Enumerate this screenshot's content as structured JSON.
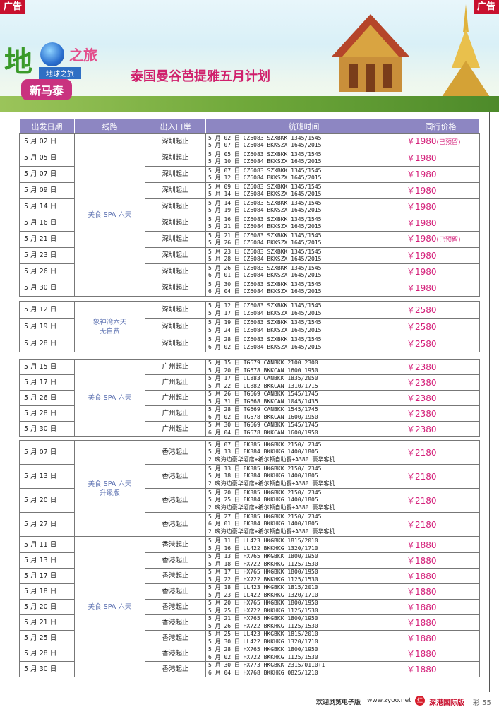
{
  "ad_label": "广告",
  "banner": {
    "logo_char": "地",
    "logo_brand": "Earth Tourism",
    "logo_zhilv": "之旅",
    "logo_caption": "地球之旅",
    "badge": "新马泰",
    "headline": "泰国曼谷芭提雅五月计划"
  },
  "columns": [
    "出发日期",
    "线路",
    "出入口岸",
    "航班时间",
    "同行价格"
  ],
  "groups": [
    {
      "route": [
        "美食 SPA 六天"
      ],
      "rows": [
        {
          "date": "5 月 02 日",
          "port": "深圳起止",
          "flights": [
            "5 月 02 日 CZ6083 SZXBKK 1345/1545",
            "5 月 07 日 CZ6084 BKKSZX 1645/2015"
          ],
          "price": "￥1980",
          "note": "(已预留)"
        },
        {
          "date": "5 月 05 日",
          "port": "深圳起止",
          "flights": [
            "5 月 05 日 CZ6083 SZXBKK 1345/1545",
            "5 月 10 日 CZ6084 BKKSZX 1645/2015"
          ],
          "price": "￥1980",
          "note": ""
        },
        {
          "date": "5 月 07 日",
          "port": "深圳起止",
          "flights": [
            "5 月 07 日 CZ6083 SZXBKK 1345/1545",
            "5 月 12 日 CZ6084 BKKSZX 1645/2015"
          ],
          "price": "￥1980",
          "note": ""
        },
        {
          "date": "5 月 09 日",
          "port": "深圳起止",
          "flights": [
            "5 月 09 日 CZ6083 SZXBKK 1345/1545",
            "5 月 14 日 CZ6084 BKKSZX 1645/2015"
          ],
          "price": "￥1980",
          "note": ""
        },
        {
          "date": "5 月 14 日",
          "port": "深圳起止",
          "flights": [
            "5 月 14 日 CZ6083 SZXBKK 1345/1545",
            "5 月 19 日 CZ6084 BKKSZX 1645/2015"
          ],
          "price": "￥1980",
          "note": ""
        },
        {
          "date": "5 月 16 日",
          "port": "深圳起止",
          "flights": [
            "5 月 16 日 CZ6083 SZXBKK 1345/1545",
            "5 月 21 日 CZ6084 BKKSZX 1645/2015"
          ],
          "price": "￥1980",
          "note": ""
        },
        {
          "date": "5 月 21 日",
          "port": "深圳起止",
          "flights": [
            "5 月 21 日 CZ6083 SZXBKK 1345/1545",
            "5 月 26 日 CZ6084 BKKSZX 1645/2015"
          ],
          "price": "￥1980",
          "note": "(已预留)"
        },
        {
          "date": "5 月 23 日",
          "port": "深圳起止",
          "flights": [
            "5 月 23 日 CZ6083 SZXBKK 1345/1545",
            "5 月 28 日 CZ6084 BKKSZX 1645/2015"
          ],
          "price": "￥1980",
          "note": ""
        },
        {
          "date": "5 月 26 日",
          "port": "深圳起止",
          "flights": [
            "5 月 26 日 CZ6083 SZXBKK 1345/1545",
            "6 月 01 日 CZ6084 BKKSZX 1645/2015"
          ],
          "price": "￥1980",
          "note": ""
        },
        {
          "date": "5 月 30 日",
          "port": "深圳起止",
          "flights": [
            "5 月 30 日 CZ6083 SZXBKK 1345/1545",
            "6 月 04 日 CZ6084 BKKSZX 1645/2015"
          ],
          "price": "￥1980",
          "note": ""
        }
      ]
    },
    {
      "route": [
        "象神湾六天",
        "无自费"
      ],
      "rows": [
        {
          "date": "5 月 12 日",
          "port": "深圳起止",
          "flights": [
            "5 月 12 日 CZ6083 SZXBKK 1345/1545",
            "5 月 17 日 CZ6084 BKKSZX 1645/2015"
          ],
          "price": "￥2580",
          "note": ""
        },
        {
          "date": "5 月 19 日",
          "port": "深圳起止",
          "flights": [
            "5 月 19 日 CZ6083 SZXBKK 1345/1545",
            "5 月 24 日 CZ6084 BKKSZX 1645/2015"
          ],
          "price": "￥2580",
          "note": ""
        },
        {
          "date": "5 月 28 日",
          "port": "深圳起止",
          "flights": [
            "5 月 28 日 CZ6083 SZXBKK 1345/1545",
            "6 月 02 日 CZ6084 BKKSZX 1645/2015"
          ],
          "price": "￥2580",
          "note": ""
        }
      ]
    },
    {
      "route": [
        "美食 SPA 六天"
      ],
      "rows": [
        {
          "date": "5 月 15 日",
          "port": "广州起止",
          "flights": [
            "5 月 15 日 TG679  CANBKK  2100 2300",
            "5 月 20 日 TG678  BKKCAN  1600 1950"
          ],
          "price": "￥2380",
          "note": ""
        },
        {
          "date": "5 月 17 日",
          "port": "广州起止",
          "flights": [
            "5 月 17 日 UL883  CANBKK  1835/2050",
            "5 月 22 日 UL882  BKKCAN  1310/1715"
          ],
          "price": "￥2380",
          "note": ""
        },
        {
          "date": "5 月 26 日",
          "port": "广州起止",
          "flights": [
            "5 月 26 日 TG669  CANBKK  1545/1745",
            "5 月 31 日 TG668  BKKCAN  1045/1435"
          ],
          "price": "￥2380",
          "note": ""
        },
        {
          "date": "5 月 28 日",
          "port": "广州起止",
          "flights": [
            "5 月 28 日 TG669  CANBKK  1545/1745",
            "6 月 02 日 TG678  BKKCAN  1600/1950"
          ],
          "price": "￥2380",
          "note": ""
        },
        {
          "date": "5 月 30 日",
          "port": "广州起止",
          "flights": [
            "5 月 30 日 TG669  CANBKK  1545/1745",
            "6 月 04 日 TG678  BKKCAN  1600/1950"
          ],
          "price": "￥2380",
          "note": ""
        }
      ]
    },
    {
      "route": [
        "美食 SPA 六天",
        "升级版"
      ],
      "rows": [
        {
          "date": "5 月 07 日",
          "port": "香港起止",
          "flights": [
            "5 月 07 日  EK385 HKGBKK  2150/ 2345",
            "5 月 13 日  EK384 BKKHKG  1400/1805",
            "2 晚海边豪华酒店+希尔顿自助餐+A380 豪华客机"
          ],
          "price": "￥2180",
          "note": ""
        },
        {
          "date": "5 月 13 日",
          "port": "香港起止",
          "flights": [
            "5 月 13 日  EK385 HKGBKK  2150/ 2345",
            "5 月 18 日  EK384 BKKHKG  1400/1805",
            "2 晚海边豪华酒店+希尔顿自助餐+A380 豪华客机"
          ],
          "price": "￥2180",
          "note": ""
        },
        {
          "date": "5 月 20 日",
          "port": "香港起止",
          "flights": [
            "5 月 20 日  EK385 HKGBKK  2150/ 2345",
            "5 月 25 日  EK384 BKKHKG  1400/1805",
            "2 晚海边豪华酒店+希尔顿自助餐+A380 豪华客机"
          ],
          "price": "￥2180",
          "note": ""
        },
        {
          "date": "5 月 27 日",
          "port": "香港起止",
          "flights": [
            "5 月 27 日  EK385 HKGBKK  2150/ 2345",
            "6 月 01 日  EK384 BKKHKG  1400/1805",
            "2 晚海边豪华酒店+希尔顿自助餐+A380 豪华客机"
          ],
          "price": "￥2180",
          "note": ""
        }
      ]
    },
    {
      "route": [
        "美食 SPA 六天"
      ],
      "rows": [
        {
          "date": "5 月 11 日",
          "port": "香港起止",
          "flights": [
            "5 月 11 日 UL423  HKGBKK 1815/2010",
            "5 月 16 日 UL422  BKKHKG 1320/1710"
          ],
          "price": "￥1880",
          "note": ""
        },
        {
          "date": "5 月 13 日",
          "port": "香港起止",
          "flights": [
            "5 月 13 日 HX765  HKGBKK 1800/1950",
            "5 月 18 日 HX722  BKKHKG 1125/1530"
          ],
          "price": "￥1880",
          "note": ""
        },
        {
          "date": "5 月 17 日",
          "port": "香港起止",
          "flights": [
            "5 月 17 日 HX765  HKGBKK 1800/1950",
            "5 月 22 日 HX722  BKKHKG 1125/1530"
          ],
          "price": "￥1880",
          "note": ""
        },
        {
          "date": "5 月 18 日",
          "port": "香港起止",
          "flights": [
            "5 月 18 日 UL423  HKGBKK 1815/2010",
            "5 月 23 日 UL422  BKKHKG 1320/1710"
          ],
          "price": "￥1880",
          "note": ""
        },
        {
          "date": "5 月 20 日",
          "port": "香港起止",
          "flights": [
            "5 月 20 日 HX765  HKGBKK 1800/1950",
            "5 月 25 日 HX722  BKKHKG 1125/1530"
          ],
          "price": "￥1880",
          "note": ""
        },
        {
          "date": "5 月 21 日",
          "port": "香港起止",
          "flights": [
            "5 月 21 日 HX765  HKGBKK 1800/1950",
            "5 月 26 日 HX722  BKKHKG 1125/1530"
          ],
          "price": "￥1880",
          "note": ""
        },
        {
          "date": "5 月 25 日",
          "port": "香港起止",
          "flights": [
            "5 月 25 日 UL423  HKGBKK 1815/2010",
            "5 月 30 日 UL422  BKKHKG 1320/1710"
          ],
          "price": "￥1880",
          "note": ""
        },
        {
          "date": "5 月 28 日",
          "port": "香港起止",
          "flights": [
            "5 月 28 日 HX765  HKGBKK 1800/1950",
            "6 月 02 日 HX722  BKKHKG 1125/1530"
          ],
          "price": "￥1880",
          "note": ""
        },
        {
          "date": "5 月 30 日",
          "port": "香港起止",
          "flights": [
            "5 月 30 日 HX773  HKGBKK 2315/0110+1",
            "6 月 04 日 HX768  BKKHKG 0825/1210"
          ],
          "price": "￥1880",
          "note": ""
        }
      ]
    }
  ],
  "footer": {
    "welcome": "欢迎浏览电子版",
    "site": "www.zyoo.net",
    "logo_char": "红",
    "edition": "深港国际版",
    "page": "彩 55"
  },
  "colors": {
    "ad": "#c8102e",
    "header": "#8d86c2",
    "price": "#d4207a",
    "route": "#5a6fb0",
    "headline": "#d0206c"
  }
}
